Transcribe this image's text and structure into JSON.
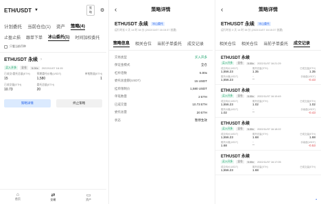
{
  "screen1": {
    "pair": "ETH/USDT",
    "badge": "策略",
    "tabs": [
      "计划委托",
      "当前仓位(1)",
      "资产",
      "策略(4)"
    ],
    "sub_tabs": [
      "止盈止损",
      "跟单下单",
      "冰山委托(1)",
      "时间加权委托"
    ],
    "filter_label": "只看当前币种",
    "order": {
      "name": "ETHUSDT 永续",
      "tags": [
        "买入开多",
        "全仓",
        "5.00x"
      ],
      "time": "2022/11/07 16:15",
      "stats": [
        {
          "label": "已成交/委托总量(ETH)",
          "value": "15"
        },
        {
          "label": "预期委托价格(USDT)",
          "value": "1,580"
        },
        {
          "label": "单笔数量(ETH)",
          "value": "1"
        },
        {
          "label": "已成交量(ETH)",
          "value": "10.73"
        },
        {
          "label": "委托总量(ETH)",
          "value": "20"
        },
        {
          "label": "",
          "value": ""
        }
      ]
    },
    "buttons": {
      "details": "策略详情",
      "stop": "终止策略"
    },
    "nav": [
      "首页",
      "交易",
      "资产"
    ]
  },
  "screen2": {
    "title": "策略详情",
    "name": "ETHUSDT 永续",
    "tag": "冰山委托",
    "meta": "运行时长 0 天 14 时 38 分 (2022/11/07 16:15:37 创建)",
    "tabs": [
      "策略信息",
      "相关仓位",
      "当前子单委托",
      "成交记录"
    ],
    "rows": [
      {
        "label": "交易类型",
        "value": "买入开多",
        "green": true
      },
      {
        "label": "保证金模式",
        "value": "全仓"
      },
      {
        "label": "杠杆倍数",
        "value": "5.00x"
      },
      {
        "label": "委托总金额(USDT)",
        "value": "15 USDT"
      },
      {
        "label": "挂单限制价",
        "value": "1,580 USDT"
      },
      {
        "label": "单笔数量",
        "value": "2 ETH"
      },
      {
        "label": "已成交量",
        "value": "10.73 ETH"
      },
      {
        "label": "委托总量",
        "value": "20 ETH"
      },
      {
        "label": "状态",
        "value": "暂停生效"
      }
    ]
  },
  "screen3": {
    "title": "策略详情",
    "name": "ETHUSDT 永续",
    "tag": "冰山委托",
    "meta": "运行时长 0 天 14 时 38 分 (2022/11/07 16:15:37 创建)",
    "tabs": [
      "相关仓位",
      "相关仓位",
      "当前子单委托",
      "成交记录"
    ],
    "cards": [
      {
        "name": "ETHUSDT 永续",
        "time": "2022/11/07 16:21:29",
        "cells": [
          [
            "成交均价(USDT)",
            "1,556.23"
          ],
          [
            "委托总量(ETH)",
            "1.35"
          ],
          [
            "已成交量(ETH)",
            "1.35"
          ],
          [
            "委托价格(USDT)",
            "1,556.23"
          ],
          [
            "--",
            "--"
          ],
          [
            "手续费(USDT)",
            "-0.43"
          ]
        ]
      },
      {
        "name": "ETHUSDT 永续",
        "time": "2022/11/07 16:19:49",
        "cells": [
          [
            "成交均价(USDT)",
            "1,556.23"
          ],
          [
            "委托总量(ETH)",
            "1.02"
          ],
          [
            "已成交量(ETH)",
            "1.02"
          ],
          [
            "委托价格(USDT)",
            "1.02"
          ],
          [
            "--",
            "--"
          ],
          [
            "手续费(USDT)",
            "-0.43"
          ]
        ]
      },
      {
        "name": "ETHUSDT 永续",
        "time": "2022/11/07 16:18:22",
        "cells": [
          [
            "成交均价(USDT)",
            "1,556.23"
          ],
          [
            "委托总量(ETH)",
            "1.68"
          ],
          [
            "已成交量(ETH)",
            "1.68"
          ],
          [
            "委托价格(USDT)",
            "1.68"
          ],
          [
            "--",
            "--"
          ],
          [
            "手续费(USDT)",
            "-0.53"
          ]
        ]
      },
      {
        "name": "ETHUSDT 永续",
        "time": "2022/11/07 16:17:05",
        "cells": [
          [
            "成交均价(USDT)",
            "1,556.23"
          ],
          [
            "委托总量(ETH)",
            "1.68"
          ],
          [
            "已成交量(ETH)",
            ""
          ],
          [
            "委托价格(USDT)",
            ""
          ],
          [
            "",
            ""
          ],
          [
            "",
            ""
          ]
        ]
      }
    ],
    "common_tags": [
      "买入开多",
      "全仓",
      "5.00x"
    ]
  }
}
